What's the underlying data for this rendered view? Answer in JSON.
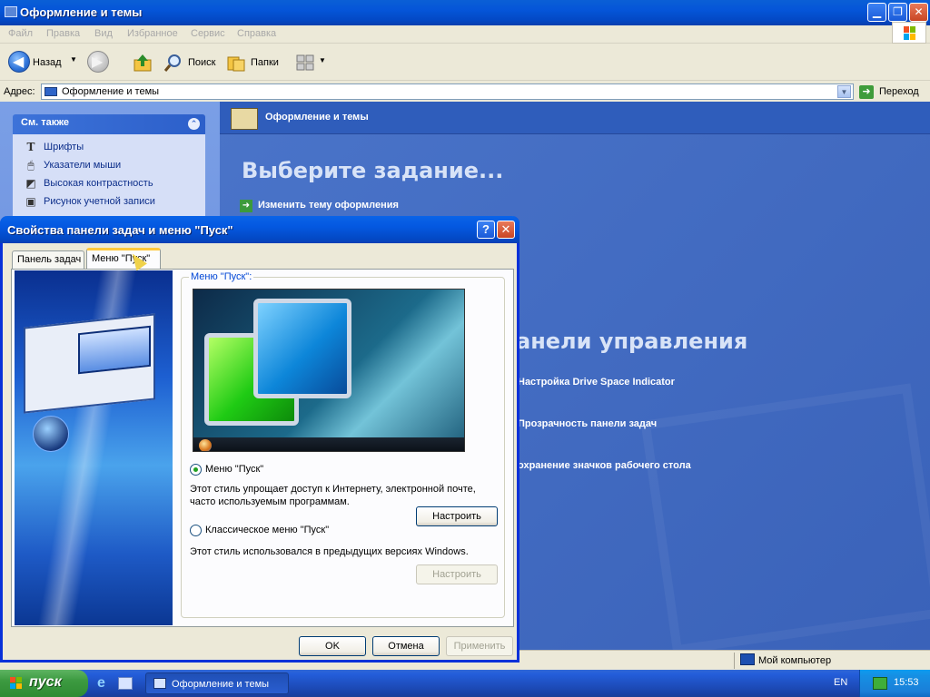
{
  "window": {
    "title": "Оформление и темы",
    "minimize": "▁",
    "maximize": "❐",
    "close": "✕"
  },
  "menu": [
    "Файл",
    "Правка",
    "Вид",
    "Избранное",
    "Сервис",
    "Справка"
  ],
  "toolbar": {
    "back": "Назад",
    "search": "Поиск",
    "folders": "Папки"
  },
  "address": {
    "label": "Адрес:",
    "value": "Оформление и темы",
    "go": "Переход"
  },
  "see_also": {
    "title": "См. также",
    "items": [
      {
        "label": "Шрифты",
        "icon": "fonts-icon"
      },
      {
        "label": "Указатели мыши",
        "icon": "mouse-icon"
      },
      {
        "label": "Высокая контрастность",
        "icon": "contrast-icon"
      },
      {
        "label": "Рисунок учетной записи",
        "icon": "user-picture-icon"
      }
    ]
  },
  "content": {
    "header": "Оформление и темы",
    "pick_task": "Выберите задание...",
    "task_1": "Изменить тему оформления",
    "cp_title": "анели управления",
    "cp_items": [
      "Настройка Drive Space Indicator",
      "Прозрачность панели задач",
      "охранение значков рабочего стола"
    ]
  },
  "status": {
    "computer": "Мой компьютер"
  },
  "dialog": {
    "title": "Свойства панели задач и меню \"Пуск\"",
    "help": "?",
    "close": "✕",
    "tabs": [
      "Панель задач",
      "Меню \"Пуск\""
    ],
    "active_tab": 1,
    "group_label": "Меню \"Пуск\":",
    "option_1": {
      "label": "Меню \"Пуск\"",
      "checked": true,
      "desc_1": "Этот стиль упрощает доступ к Интернету, электронной почте,",
      "desc_2": "часто используемым программам.",
      "button": "Настроить"
    },
    "option_2": {
      "label": "Классическое меню \"Пуск\"",
      "checked": false,
      "desc": "Этот стиль использовался в предыдущих версиях Windows.",
      "button": "Настроить"
    },
    "ok": "OK",
    "cancel": "Отмена",
    "apply": "Применить"
  },
  "taskbar": {
    "start": "пуск",
    "task": "Оформление и темы",
    "lang": "EN",
    "clock": "15:53"
  },
  "colors": {
    "xp_blue": "#0348c4",
    "content_blue": "#3a62b9",
    "start_green": "#3c9a40"
  }
}
